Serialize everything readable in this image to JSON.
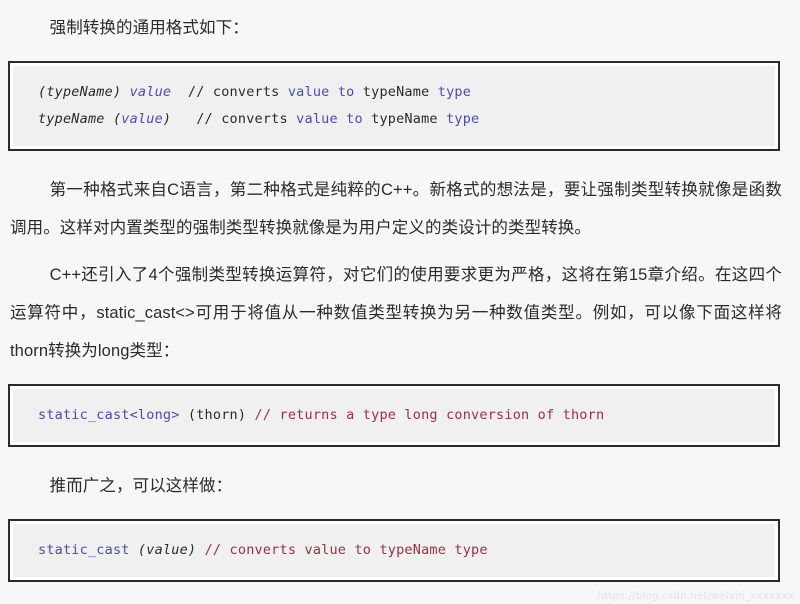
{
  "document": {
    "language": "zh-CN",
    "background_color": "#f7f7f9",
    "text_color": "#2b2b2b"
  },
  "colors": {
    "page_background": "#f7f7f9",
    "code_border": "#2b2b2b",
    "code_background": "#f0f0f0",
    "keyword_blue": "#4a4ab8",
    "comment_red": "#a03040",
    "body_text": "#2b2b2b",
    "watermark": "#e2e2e6"
  },
  "content": {
    "lead_line": "强制转换的通用格式如下：",
    "code_block_1": {
      "line1": {
        "seg1": "(typeName) ",
        "seg2": "value",
        "seg3": "  // converts ",
        "seg4": "value",
        "seg5": " ",
        "seg6": "to",
        "seg7": " typeName ",
        "seg8": "type"
      },
      "line2": {
        "seg1": "typeName (",
        "seg2": "value",
        "seg3": ")",
        "seg4": "   // converts ",
        "seg5": "value",
        "seg6": " ",
        "seg7": "to",
        "seg8": " typeName ",
        "seg9": "type"
      }
    },
    "paragraph_1": "第一种格式来自C语言，第二种格式是纯粹的C++。新格式的想法是，要让强制类型转换就像是函数调用。这样对内置类型的强制类型转换就像是为用户定义的类设计的类型转换。",
    "paragraph_2": "C++还引入了4个强制类型转换运算符，对它们的使用要求更为严格，这将在第15章介绍。在这四个运算符中，static_cast<>可用于将值从一种数值类型转换为另一种数值类型。例如，可以像下面这样将thorn转换为long类型：",
    "code_block_2": {
      "seg1": "static_cast",
      "seg2": "<long>",
      "seg3": " (thorn) ",
      "seg4": "// returns a type long conversion of thorn"
    },
    "mid_line": "推而广之，可以这样做：",
    "code_block_3": {
      "seg1": "static_cast",
      "seg2": " (value) ",
      "seg3": "// converts value to typeName type"
    },
    "watermark": "https://blog.csdn.net/weixin_xxxxxxx"
  }
}
